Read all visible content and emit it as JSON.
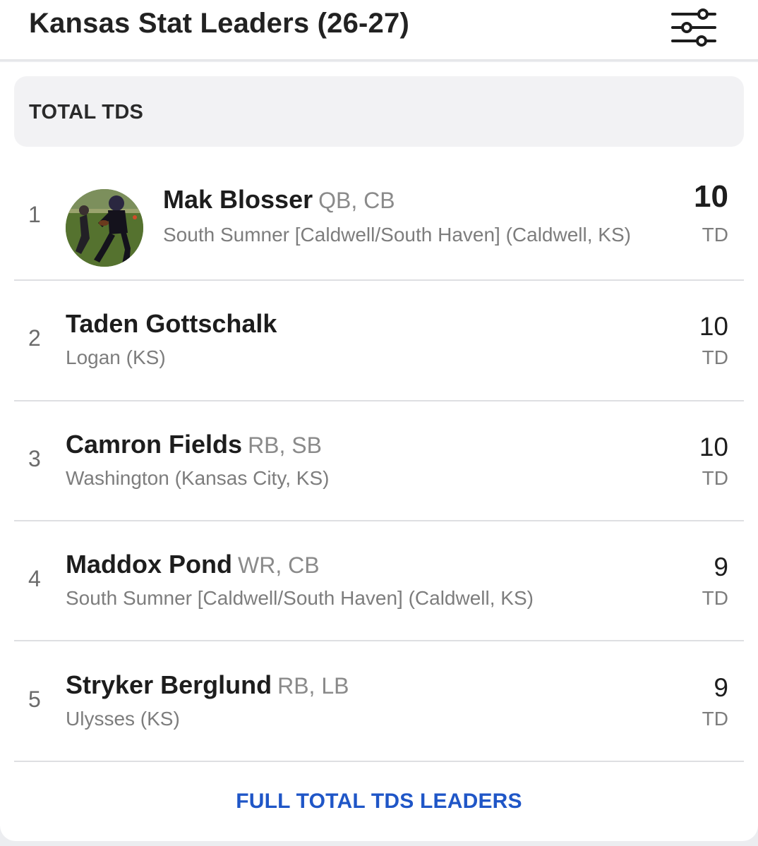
{
  "header": {
    "title": "Kansas Stat Leaders (26-27)",
    "filter_icon": "sliders-icon"
  },
  "section": {
    "title": "TOTAL TDS"
  },
  "leaders": [
    {
      "rank": "1",
      "name": "Mak Blosser",
      "positions": "QB, CB",
      "school": "South Sumner [Caldwell/South Haven] (Caldwell, KS)",
      "value": "10",
      "unit": "TD",
      "has_photo": true
    },
    {
      "rank": "2",
      "name": "Taden Gottschalk",
      "positions": "",
      "school": "Logan (KS)",
      "value": "10",
      "unit": "TD"
    },
    {
      "rank": "3",
      "name": "Camron Fields",
      "positions": "RB, SB",
      "school": "Washington (Kansas City, KS)",
      "value": "10",
      "unit": "TD"
    },
    {
      "rank": "4",
      "name": "Maddox Pond",
      "positions": "WR, CB",
      "school": "South Sumner [Caldwell/South Haven] (Caldwell, KS)",
      "value": "9",
      "unit": "TD"
    },
    {
      "rank": "5",
      "name": "Stryker Berglund",
      "positions": "RB, LB",
      "school": "Ulysses (KS)",
      "value": "9",
      "unit": "TD"
    }
  ],
  "footer": {
    "link_label": "FULL TOTAL TDS LEADERS"
  },
  "colors": {
    "link": "#1f56c7",
    "section_bg": "#f2f2f4",
    "divider": "#dedfe2"
  }
}
